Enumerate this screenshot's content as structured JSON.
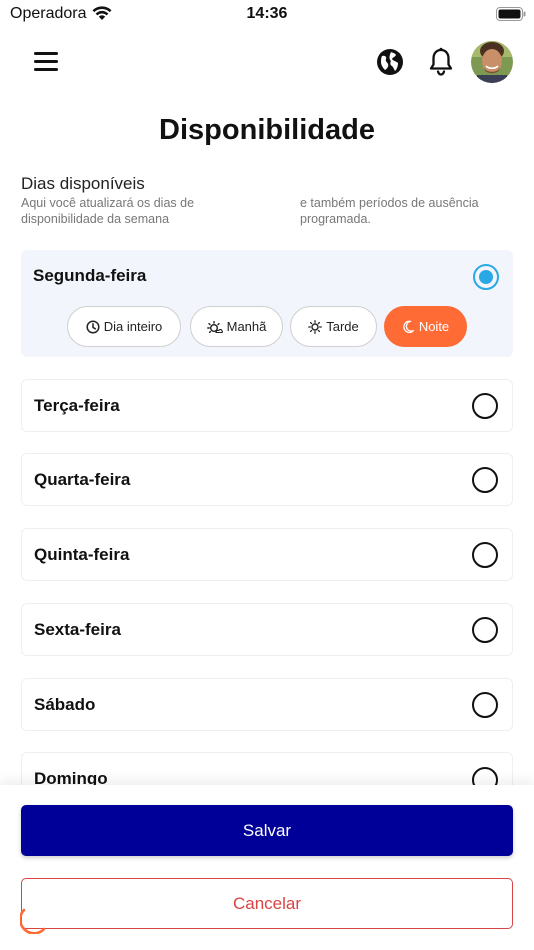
{
  "status_bar": {
    "carrier": "Operadora",
    "time": "14:36"
  },
  "header": {
    "menu_icon": "hamburger-menu-icon",
    "language_icon": "globe-icon",
    "notifications_icon": "bell-icon"
  },
  "page": {
    "title": "Disponibilidade",
    "section_title": "Dias disponíveis",
    "description_left": "Aqui você atualizará os dias de disponibilidade da semana",
    "description_right": "e também períodos de ausência programada."
  },
  "days": [
    {
      "name": "Segunda-feira",
      "selected": true,
      "periods": [
        {
          "label": "Dia inteiro",
          "icon": "clock-icon",
          "selected": false
        },
        {
          "label": "Manhã",
          "icon": "sunrise-icon",
          "selected": false
        },
        {
          "label": "Tarde",
          "icon": "sun-icon",
          "selected": false
        },
        {
          "label": "Noite",
          "icon": "moon-icon",
          "selected": true
        }
      ]
    },
    {
      "name": "Terça-feira",
      "selected": false
    },
    {
      "name": "Quarta-feira",
      "selected": false
    },
    {
      "name": "Quinta-feira",
      "selected": false
    },
    {
      "name": "Sexta-feira",
      "selected": false
    },
    {
      "name": "Sábado",
      "selected": false
    },
    {
      "name": "Domingo",
      "selected": false
    }
  ],
  "actions": {
    "save": "Salvar",
    "cancel": "Cancelar"
  },
  "colors": {
    "primary": "#000099",
    "accent": "#ff6b35",
    "radio_selected": "#2aa8e6",
    "cancel": "#d94444"
  }
}
